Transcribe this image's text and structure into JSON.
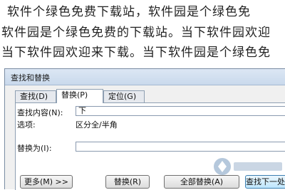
{
  "document": {
    "line1": "软件个绿色免费下载站，软件园是个绿色免",
    "line2": "软件园是个绿色免费的下载站。当下软件园欢迎",
    "line3": "当下软件园欢迎来下载。当下软件园是个绿色免"
  },
  "dialog": {
    "title": "查找和替换",
    "tabs": [
      {
        "label": "查找(D)"
      },
      {
        "label": "替换(P)"
      },
      {
        "label": "定位(G)"
      }
    ],
    "find": {
      "label": "查找内容(N):",
      "value": "下"
    },
    "options": {
      "label": "选项:",
      "value": "区分全/半角"
    },
    "replace": {
      "label": "替换为(I):",
      "value": ""
    },
    "buttons": {
      "more": "更多(M) >>",
      "replace": "替换(R)",
      "replace_all": "全部替换(A)",
      "find_next": "查找下一处(F)"
    }
  },
  "colors": {
    "titlebar": "#dce7f4",
    "primary_button": "#bee6fd"
  }
}
